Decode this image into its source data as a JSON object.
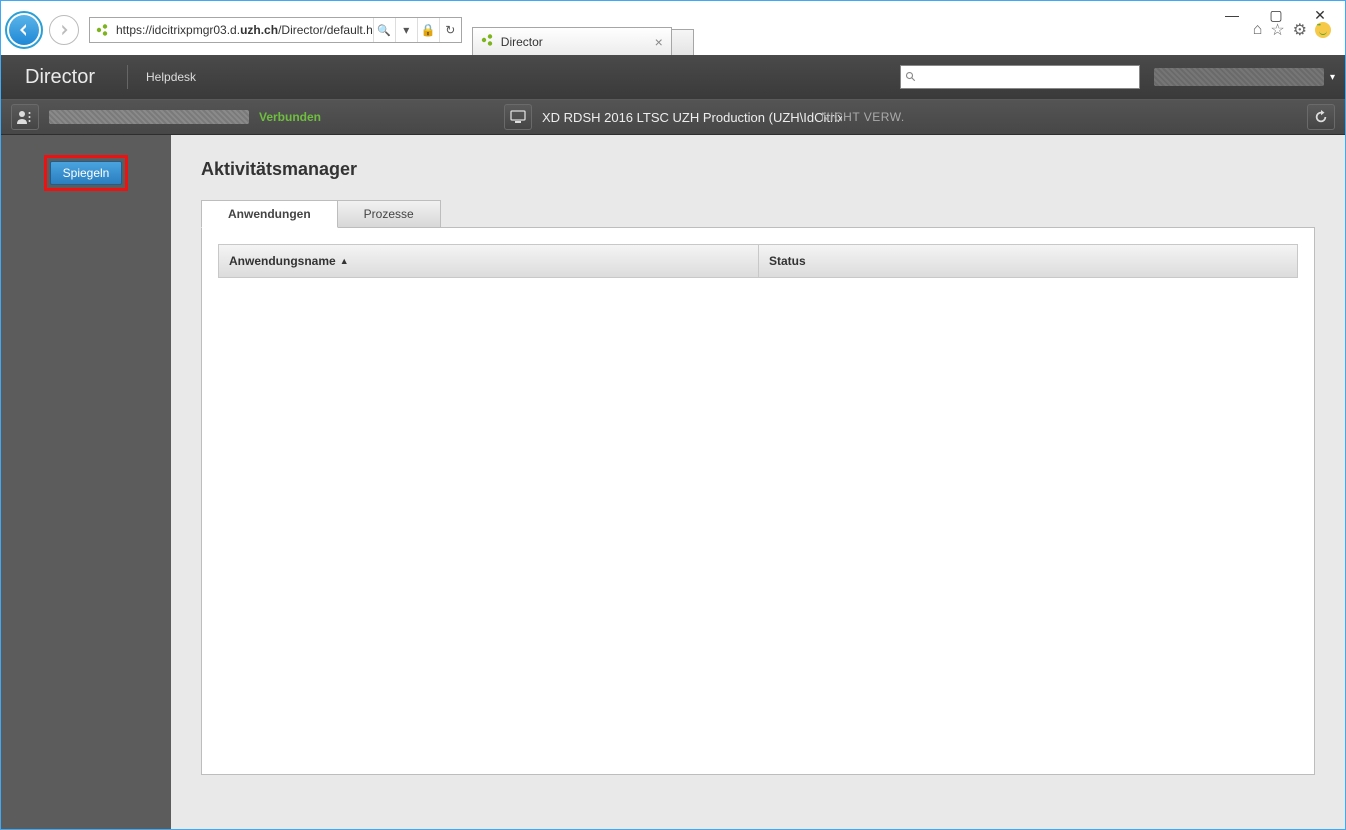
{
  "window": {
    "min": "—",
    "max": "▢",
    "close": "✕"
  },
  "ie": {
    "url_prefix": "https://idcitrixpmgr03.d.",
    "url_bold": "uzh.ch",
    "url_suffix": "/Director/default.h",
    "search_glyph": "🔍",
    "dropdown_glyph": "▾",
    "lock_glyph": "🔒",
    "refresh_glyph": "↻",
    "tab_title": "Director",
    "tab_close": "×",
    "home_glyph": "⌂",
    "star_glyph": "☆",
    "gear_glyph": "⚙"
  },
  "app": {
    "title": "Director",
    "helpdesk": "Helpdesk",
    "caret": "▾"
  },
  "status": {
    "connected": "Verbunden",
    "session": "XD RDSH 2016 LTSC UZH Production (UZH\\IdCitrixP...",
    "not_managed": "NICHT VERW."
  },
  "sidebar": {
    "spiegeln": "Spiegeln"
  },
  "content": {
    "heading": "Aktivitätsmanager",
    "tab_apps": "Anwendungen",
    "tab_procs": "Prozesse",
    "col_name": "Anwendungsname",
    "col_status": "Status",
    "sort_arrow": "▲"
  }
}
